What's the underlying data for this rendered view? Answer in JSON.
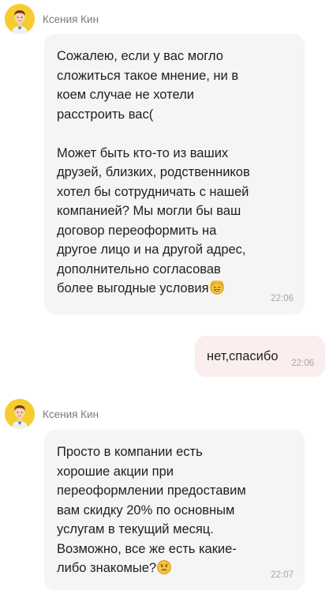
{
  "messages": [
    {
      "sender": "Ксения Кин",
      "text": "Сожалею, если у вас могло\nсложиться такое мнение, ни в\nкоем случае не хотели\nрасстроить вас(\n\nМожет быть кто-то из ваших\nдрузей, близких, родственников\nхотел бы сотрудничать с нашей\nкомпанией? Мы могли бы ваш\nдоговор переоформить на\nдругое лицо и на другой адрес,\nдополнительно согласовав\nболее выгодные условия",
      "emoji": "smiling-cat-emoji",
      "time": "22:06"
    },
    {
      "sender": "me",
      "text": "нет,спасибо",
      "time": "22:06"
    },
    {
      "sender": "Ксения Кин",
      "text": "Просто в компании есть\nхорошие акции при\nпереоформлении предоставим\nвам скидку 20% по основным\nуслугам в текущий месяц.\nВозможно, все же есть какие-\nлибо знакомые?",
      "emoji": "worried-face-emoji",
      "time": "22:07"
    }
  ],
  "colors": {
    "avatar_bg": "#f7cd2d",
    "incoming_bubble": "#f5f5f5",
    "outgoing_bubble": "#fbeeee",
    "time_text": "#a7a7a7",
    "sender_name": "#7b7b7b"
  }
}
